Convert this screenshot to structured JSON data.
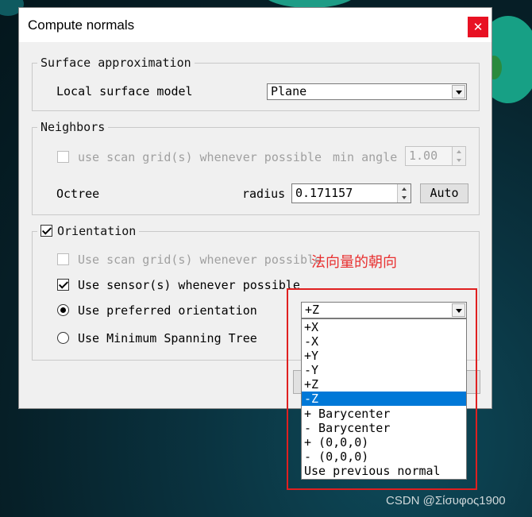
{
  "dialog": {
    "title": "Compute normals",
    "close_glyph": "✕"
  },
  "surface": {
    "legend": "Surface approximation",
    "model_label": "Local surface model",
    "model_value": "Plane"
  },
  "neighbors": {
    "legend": "Neighbors",
    "scan_grid_label": "use scan grid(s) whenever possible",
    "min_angle_label": "min angle",
    "min_angle_value": "1.00",
    "octree_label": "Octree",
    "radius_label": "radius",
    "radius_value": "0.171157",
    "auto_label": "Auto"
  },
  "orientation": {
    "legend": "Orientation",
    "enabled": true,
    "scan_grid_label": "Use scan grid(s)  whenever possible",
    "sensor_label": "Use sensor(s) whenever possible",
    "preferred_label": "Use preferred orientation",
    "mst_label": "Use Minimum Spanning Tree",
    "preferred_value": "+Z",
    "options": [
      "+X",
      "-X",
      "+Y",
      "-Y",
      "+Z",
      "-Z",
      "+ Barycenter",
      "- Barycenter",
      "+ (0,0,0)",
      "- (0,0,0)",
      "Use previous normal"
    ],
    "highlighted_option": "-Z"
  },
  "annotation": {
    "text": "法向量的朝向",
    "color": "#e83030"
  },
  "watermark": {
    "text": "CSDN @Σίσυφος1900"
  },
  "colors": {
    "close_button": "#e81123",
    "selection": "#0078d7",
    "annotation_box": "#e02020"
  }
}
